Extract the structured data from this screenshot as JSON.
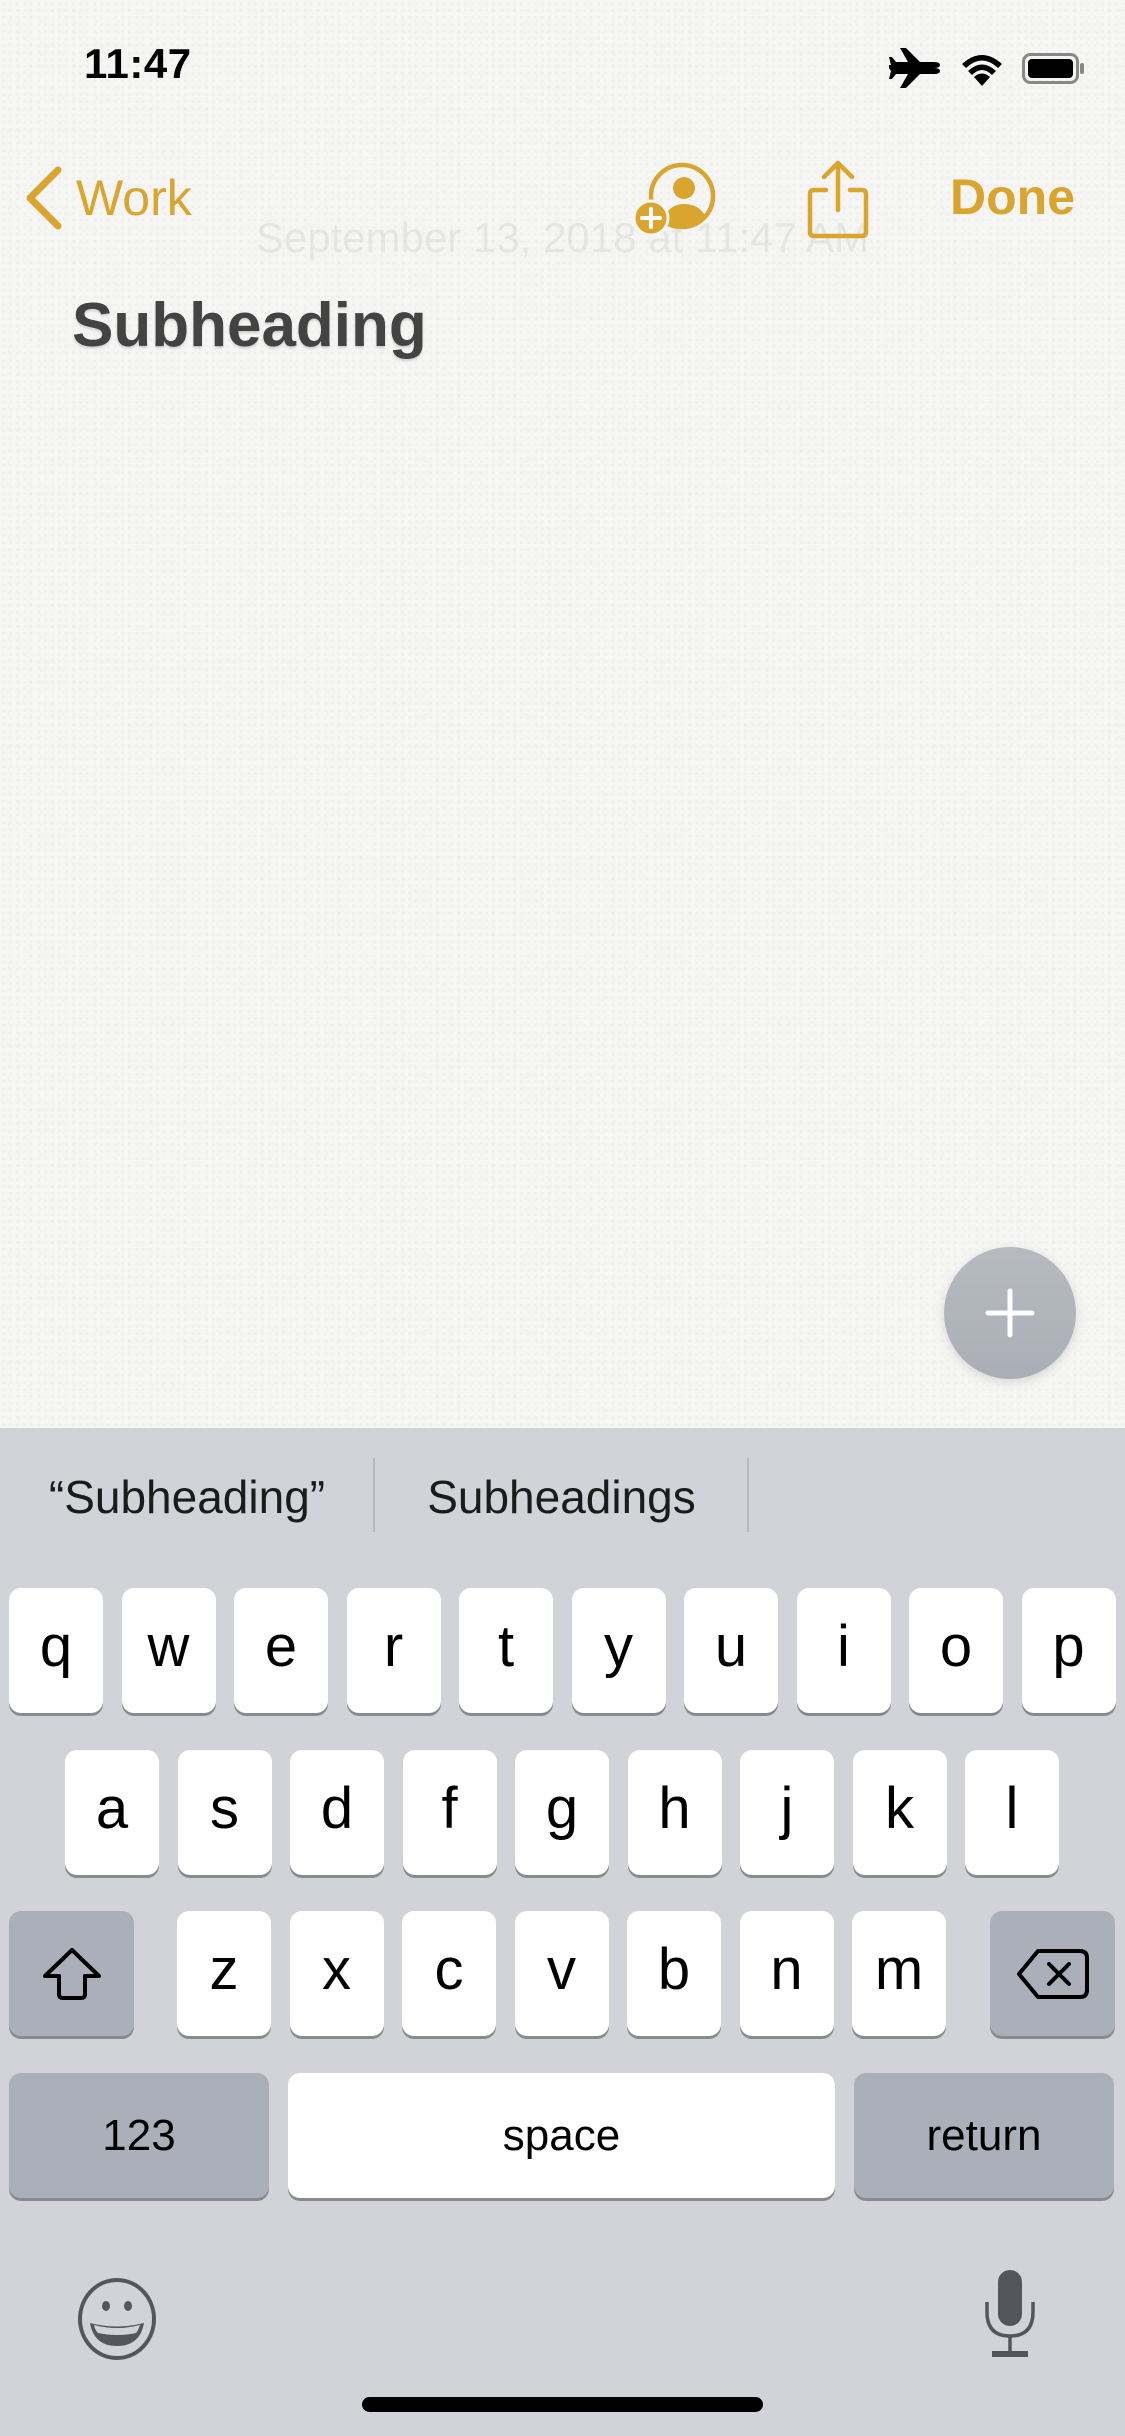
{
  "status_bar": {
    "time": "11:47",
    "icons": [
      "airplane-mode-icon",
      "wifi-icon",
      "battery-icon"
    ]
  },
  "nav": {
    "back_label": "Work",
    "back_icon": "chevron-left-icon",
    "collaborate_icon": "add-person-icon",
    "share_icon": "share-icon",
    "done_label": "Done",
    "accent_color": "#D9A52F"
  },
  "note": {
    "date": "September 13, 2018 at 11:47 AM",
    "subheading": "Subheading"
  },
  "fab": {
    "icon": "plus-icon"
  },
  "keyboard": {
    "suggestions": [
      "“Subheading”",
      "Subheadings",
      ""
    ],
    "rows": [
      [
        "q",
        "w",
        "e",
        "r",
        "t",
        "y",
        "u",
        "i",
        "o",
        "p"
      ],
      [
        "a",
        "s",
        "d",
        "f",
        "g",
        "h",
        "j",
        "k",
        "l"
      ],
      [
        "z",
        "x",
        "c",
        "v",
        "b",
        "n",
        "m"
      ]
    ],
    "shift_icon": "shift-icon",
    "delete_icon": "delete-backward-icon",
    "numbers_label": "123",
    "space_label": "space",
    "return_label": "return",
    "emoji_icon": "emoji-icon",
    "dictation_icon": "microphone-icon"
  }
}
